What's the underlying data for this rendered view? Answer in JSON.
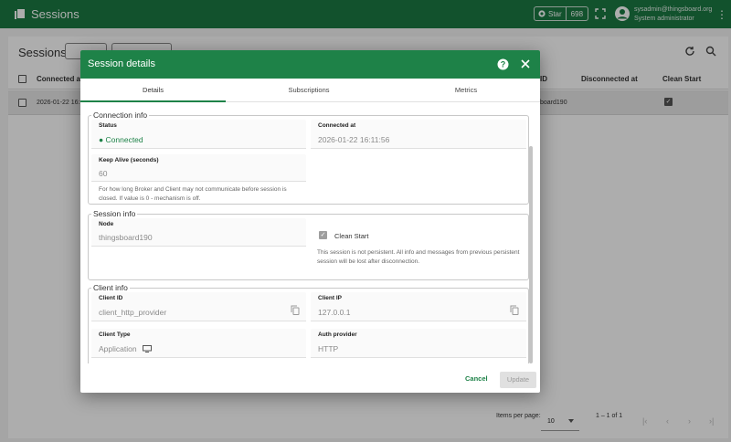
{
  "topbar": {
    "title": "Sessions",
    "star_label": "Star",
    "star_count": "698",
    "user_email": "sysadmin@thingsboard.org",
    "user_role": "System administrator"
  },
  "page": {
    "title": "Sessions",
    "columns": {
      "connected_at": "Connected at",
      "client_id_tail": "ID",
      "disconnected_at": "Disconnected at",
      "clean_start": "Clean Start"
    },
    "row": {
      "connected_at": "2026-01-22 16:1",
      "node_tail": "board190"
    },
    "pager": {
      "items_per_page_label": "Items per page:",
      "items_per_page": "10",
      "range": "1 – 1 of 1"
    }
  },
  "dialog": {
    "title": "Session details",
    "tabs": [
      "Details",
      "Subscriptions",
      "Metrics"
    ],
    "connection": {
      "legend": "Connection info",
      "status_label": "Status",
      "status_value": "Connected",
      "connected_at_label": "Connected at",
      "connected_at_value": "2026-01-22 16:11:56",
      "keep_alive_label": "Keep Alive (seconds)",
      "keep_alive_value": "60",
      "keep_alive_hint_1": "For how long Broker and Client may not communicate before session is",
      "keep_alive_hint_2": "closed. If value is 0 - mechanism is off."
    },
    "session": {
      "legend": "Session info",
      "node_label": "Node",
      "node_value": "thingsboard190",
      "clean_start_label": "Clean Start",
      "clean_start_hint_1": "This session is not persistent. All info and messages from previous persistent",
      "clean_start_hint_2": "session will be lost after disconnection."
    },
    "client": {
      "legend": "Client info",
      "client_id_label": "Client ID",
      "client_id_value": "client_http_provider",
      "client_ip_label": "Client IP",
      "client_ip_value": "127.0.0.1",
      "client_type_label": "Client Type",
      "client_type_value": "Application",
      "auth_provider_label": "Auth provider",
      "auth_provider_value": "HTTP"
    },
    "footer": {
      "cancel": "Cancel",
      "update": "Update"
    }
  },
  "colors": {
    "brand": "#1b7a43",
    "dialog_header": "#1e8248",
    "status_green": "#1e8248"
  }
}
